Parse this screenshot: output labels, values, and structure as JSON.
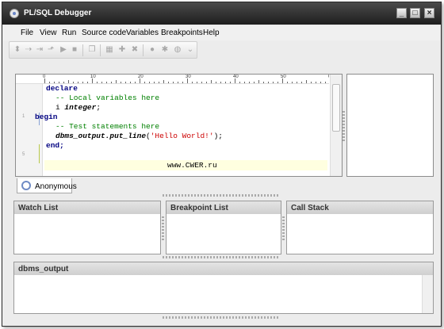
{
  "window": {
    "title": "PL/SQL Debugger"
  },
  "menu": [
    {
      "label": "File"
    },
    {
      "label": "View"
    },
    {
      "label": "Run"
    },
    {
      "label": "Source code"
    },
    {
      "label": "Variables"
    },
    {
      "label": "Breakpoints"
    },
    {
      "label": "Help"
    }
  ],
  "editor": {
    "ruler_numbers": [
      "0",
      "10",
      "20",
      "30",
      "40",
      "50",
      "60"
    ],
    "line_numbers": [
      "1",
      "5"
    ],
    "lines": {
      "l1": "declare",
      "l2": "-- Local variables here",
      "l3_a": "i ",
      "l3_b": "integer",
      "l3_c": ";",
      "l4": "begin",
      "l5": "-- Test statements here",
      "l6_a": "dbms_output.put_line",
      "l6_b": "(",
      "l6_c": "'Hello World!'",
      "l6_d": ");",
      "l7": "end;",
      "l8": "www.CWER.ru"
    }
  },
  "tabs": [
    {
      "label": "Anonymous"
    }
  ],
  "panels": {
    "watch": "Watch List",
    "breakpoints": "Breakpoint List",
    "callstack": "Call Stack",
    "output": "dbms_output"
  }
}
